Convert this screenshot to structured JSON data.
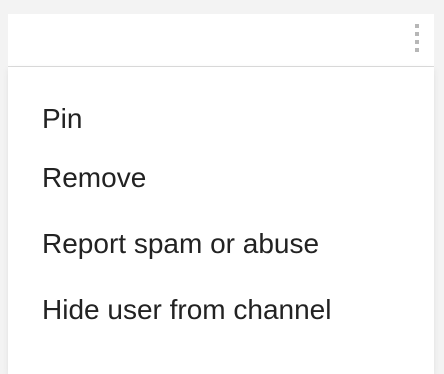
{
  "header": {
    "more_icon": "vertical-dots-icon"
  },
  "menu": {
    "items": [
      {
        "label": "Pin"
      },
      {
        "label": "Remove"
      },
      {
        "label": "Report spam or abuse"
      },
      {
        "label": "Hide user from channel"
      }
    ]
  },
  "colors": {
    "background": "#ffffff",
    "page_gray": "#f3f3f3",
    "divider": "#dcdcdc",
    "text": "#222222",
    "icon_gray": "#b7b7b7"
  }
}
